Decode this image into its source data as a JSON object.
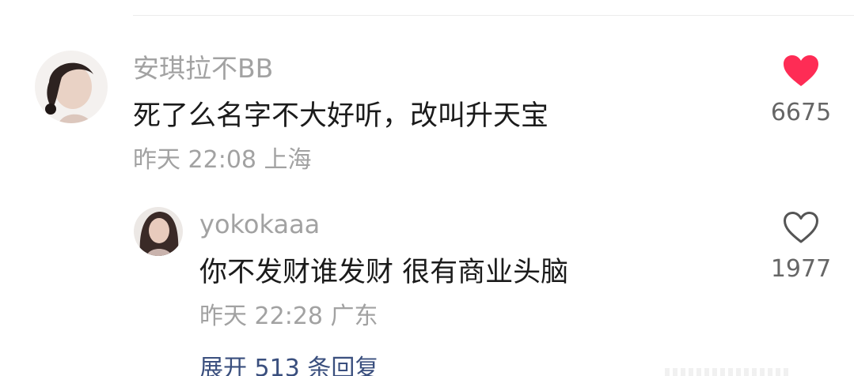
{
  "comments": [
    {
      "username": "安琪拉不BB",
      "text": "死了么名字不大好听，改叫升天宝",
      "time": "昨天 22:08",
      "location": "上海",
      "likes": "6675",
      "liked": true
    },
    {
      "username": "yokokaaa",
      "text": "你不发财谁发财 很有商业头脑",
      "time": "昨天 22:28",
      "location": "广东",
      "likes": "1977",
      "liked": false
    }
  ],
  "expand_replies": "展开 513 条回复",
  "colors": {
    "like_active": "#fe2c55",
    "like_inactive": "#555555",
    "username": "#a2a2a2",
    "content": "#1b1b1b",
    "expand_link": "#3a4f7e"
  },
  "icons": {
    "liked": "heart-filled-icon",
    "unliked": "heart-outline-icon"
  }
}
